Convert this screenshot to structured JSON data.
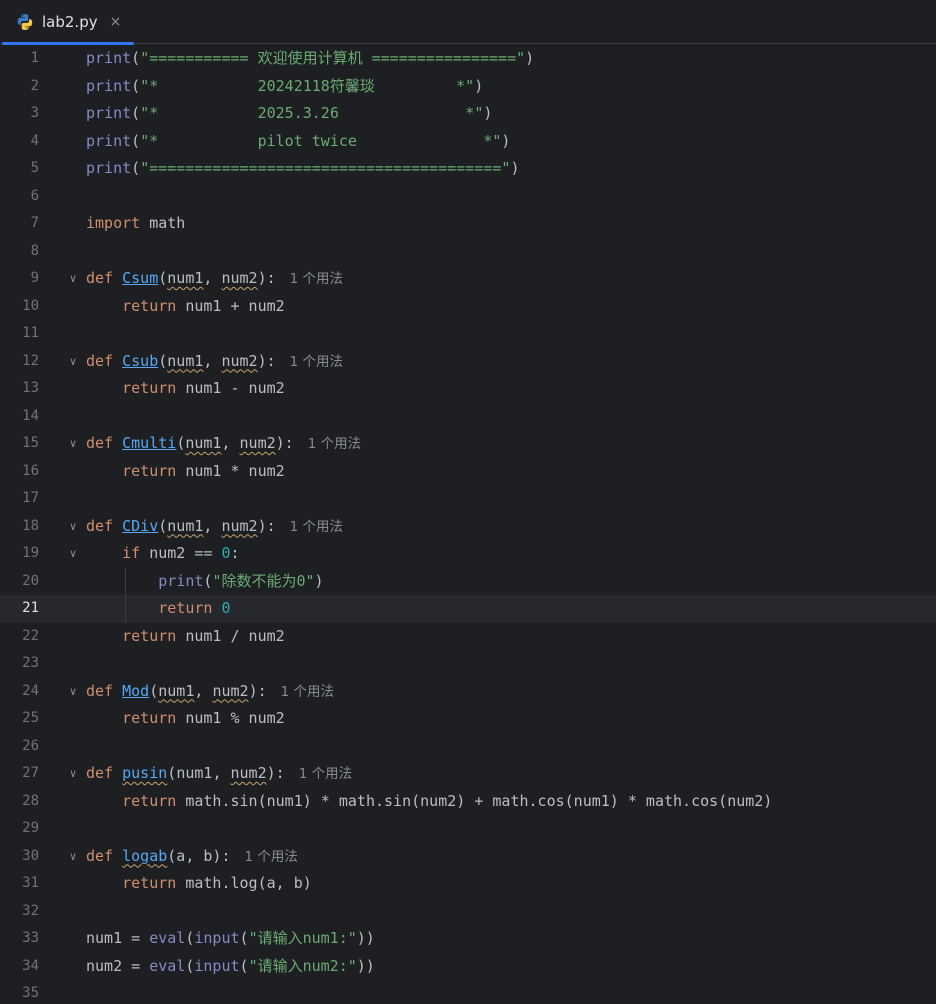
{
  "tab": {
    "filename": "lab2.py",
    "close": "×",
    "icon": "python-icon"
  },
  "colors": {
    "background": "#1e1f22",
    "keyword": "#cf8e6d",
    "builtin": "#8888c6",
    "string": "#6aab73",
    "number": "#2aacb8",
    "function": "#56a8f5",
    "accent": "#3574f0"
  },
  "current_line": 21,
  "usage_hint": "1 个用法",
  "lines": [
    {
      "n": "1",
      "t": [
        [
          "bi",
          "print"
        ],
        [
          "",
          "("
        ],
        [
          "str",
          "\"=========== 欢迎使用计算机 ================\""
        ],
        [
          "",
          ")"
        ]
      ]
    },
    {
      "n": "2",
      "t": [
        [
          "bi",
          "print"
        ],
        [
          "",
          "("
        ],
        [
          "str",
          "\"*           20242118符馨琰         *\""
        ],
        [
          "",
          ")"
        ]
      ]
    },
    {
      "n": "3",
      "t": [
        [
          "bi",
          "print"
        ],
        [
          "",
          "("
        ],
        [
          "str",
          "\"*           2025.3.26              *\""
        ],
        [
          "",
          ")"
        ]
      ]
    },
    {
      "n": "4",
      "t": [
        [
          "bi",
          "print"
        ],
        [
          "",
          "("
        ],
        [
          "str",
          "\"*           pilot twice              *\""
        ],
        [
          "",
          ")"
        ]
      ]
    },
    {
      "n": "5",
      "t": [
        [
          "bi",
          "print"
        ],
        [
          "",
          "("
        ],
        [
          "str",
          "\"=======================================\""
        ],
        [
          "",
          ")"
        ]
      ]
    },
    {
      "n": "6",
      "t": []
    },
    {
      "n": "7",
      "t": [
        [
          "kw",
          "import"
        ],
        [
          "",
          " math"
        ]
      ]
    },
    {
      "n": "8",
      "t": []
    },
    {
      "n": "9",
      "fold": true,
      "hint": true,
      "t": [
        [
          "kw",
          "def"
        ],
        [
          "",
          " "
        ],
        [
          "fn",
          "Csum"
        ],
        [
          "",
          "("
        ],
        [
          "wavy",
          "num1"
        ],
        [
          "",
          ", "
        ],
        [
          "wavy",
          "num2"
        ],
        [
          "",
          "):"
        ]
      ]
    },
    {
      "n": "10",
      "t": [
        [
          "",
          "    "
        ],
        [
          "kw",
          "return"
        ],
        [
          "",
          " num1 + num2"
        ]
      ]
    },
    {
      "n": "11",
      "t": []
    },
    {
      "n": "12",
      "fold": true,
      "hint": true,
      "t": [
        [
          "kw",
          "def"
        ],
        [
          "",
          " "
        ],
        [
          "fn",
          "Csub"
        ],
        [
          "",
          "("
        ],
        [
          "wavy",
          "num1"
        ],
        [
          "",
          ", "
        ],
        [
          "wavy",
          "num2"
        ],
        [
          "",
          "):"
        ]
      ]
    },
    {
      "n": "13",
      "t": [
        [
          "",
          "    "
        ],
        [
          "kw",
          "return"
        ],
        [
          "",
          " num1 - num2"
        ]
      ]
    },
    {
      "n": "14",
      "t": []
    },
    {
      "n": "15",
      "fold": true,
      "hint": true,
      "t": [
        [
          "kw",
          "def"
        ],
        [
          "",
          " "
        ],
        [
          "fn",
          "Cmulti"
        ],
        [
          "",
          "("
        ],
        [
          "wavy",
          "num1"
        ],
        [
          "",
          ", "
        ],
        [
          "wavy",
          "num2"
        ],
        [
          "",
          "):"
        ]
      ]
    },
    {
      "n": "16",
      "t": [
        [
          "",
          "    "
        ],
        [
          "kw",
          "return"
        ],
        [
          "",
          " num1 * num2"
        ]
      ]
    },
    {
      "n": "17",
      "t": []
    },
    {
      "n": "18",
      "fold": true,
      "hint": true,
      "t": [
        [
          "kw",
          "def"
        ],
        [
          "",
          " "
        ],
        [
          "fn",
          "CDiv"
        ],
        [
          "",
          "("
        ],
        [
          "wavy",
          "num1"
        ],
        [
          "",
          ", "
        ],
        [
          "wavy",
          "num2"
        ],
        [
          "",
          "):"
        ]
      ]
    },
    {
      "n": "19",
      "fold": true,
      "t": [
        [
          "",
          "    "
        ],
        [
          "kw",
          "if"
        ],
        [
          "",
          " num2 == "
        ],
        [
          "num",
          "0"
        ],
        [
          "",
          ":"
        ]
      ]
    },
    {
      "n": "20",
      "guide": true,
      "t": [
        [
          "",
          "        "
        ],
        [
          "bi",
          "print"
        ],
        [
          "",
          "("
        ],
        [
          "str",
          "\"除数不能为0\""
        ],
        [
          "",
          ")"
        ]
      ]
    },
    {
      "n": "21",
      "guide": true,
      "t": [
        [
          "",
          "        "
        ],
        [
          "kw",
          "return"
        ],
        [
          "",
          " "
        ],
        [
          "num",
          "0"
        ]
      ]
    },
    {
      "n": "22",
      "t": [
        [
          "",
          "    "
        ],
        [
          "kw",
          "return"
        ],
        [
          "",
          " num1 / num2"
        ]
      ]
    },
    {
      "n": "23",
      "t": []
    },
    {
      "n": "24",
      "fold": true,
      "hint": true,
      "t": [
        [
          "kw",
          "def"
        ],
        [
          "",
          " "
        ],
        [
          "fn",
          "Mod"
        ],
        [
          "",
          "("
        ],
        [
          "wavy",
          "num1"
        ],
        [
          "",
          ", "
        ],
        [
          "wavy",
          "num2"
        ],
        [
          "",
          "):"
        ]
      ]
    },
    {
      "n": "25",
      "t": [
        [
          "",
          "    "
        ],
        [
          "kw",
          "return"
        ],
        [
          "",
          " num1 % num2"
        ]
      ]
    },
    {
      "n": "26",
      "t": []
    },
    {
      "n": "27",
      "fold": true,
      "hint": true,
      "t": [
        [
          "kw",
          "def"
        ],
        [
          "",
          " "
        ],
        [
          "fnw",
          "pusin"
        ],
        [
          "",
          "("
        ],
        [
          "",
          "num1"
        ],
        [
          "",
          ", "
        ],
        [
          "wavy",
          "num2"
        ],
        [
          "",
          "):"
        ]
      ]
    },
    {
      "n": "28",
      "t": [
        [
          "",
          "    "
        ],
        [
          "kw",
          "return"
        ],
        [
          "",
          " math.sin(num1) * math.sin(num2) + math.cos(num1) * math.cos(num2)"
        ]
      ]
    },
    {
      "n": "29",
      "t": []
    },
    {
      "n": "30",
      "fold": true,
      "hint": true,
      "t": [
        [
          "kw",
          "def"
        ],
        [
          "",
          " "
        ],
        [
          "fnw",
          "logab"
        ],
        [
          "",
          "(a, b):"
        ]
      ]
    },
    {
      "n": "31",
      "t": [
        [
          "",
          "    "
        ],
        [
          "kw",
          "return"
        ],
        [
          "",
          " math.log(a, b)"
        ]
      ]
    },
    {
      "n": "32",
      "t": []
    },
    {
      "n": "33",
      "t": [
        [
          "",
          "num1 = "
        ],
        [
          "bi",
          "eval"
        ],
        [
          "",
          "("
        ],
        [
          "bi",
          "input"
        ],
        [
          "",
          "("
        ],
        [
          "str",
          "\"请输入num1:\""
        ],
        [
          "",
          "))"
        ]
      ]
    },
    {
      "n": "34",
      "t": [
        [
          "",
          "num2 = "
        ],
        [
          "bi",
          "eval"
        ],
        [
          "",
          "("
        ],
        [
          "bi",
          "input"
        ],
        [
          "",
          "("
        ],
        [
          "str",
          "\"请输入num2:\""
        ],
        [
          "",
          "))"
        ]
      ]
    },
    {
      "n": "35",
      "t": []
    }
  ]
}
